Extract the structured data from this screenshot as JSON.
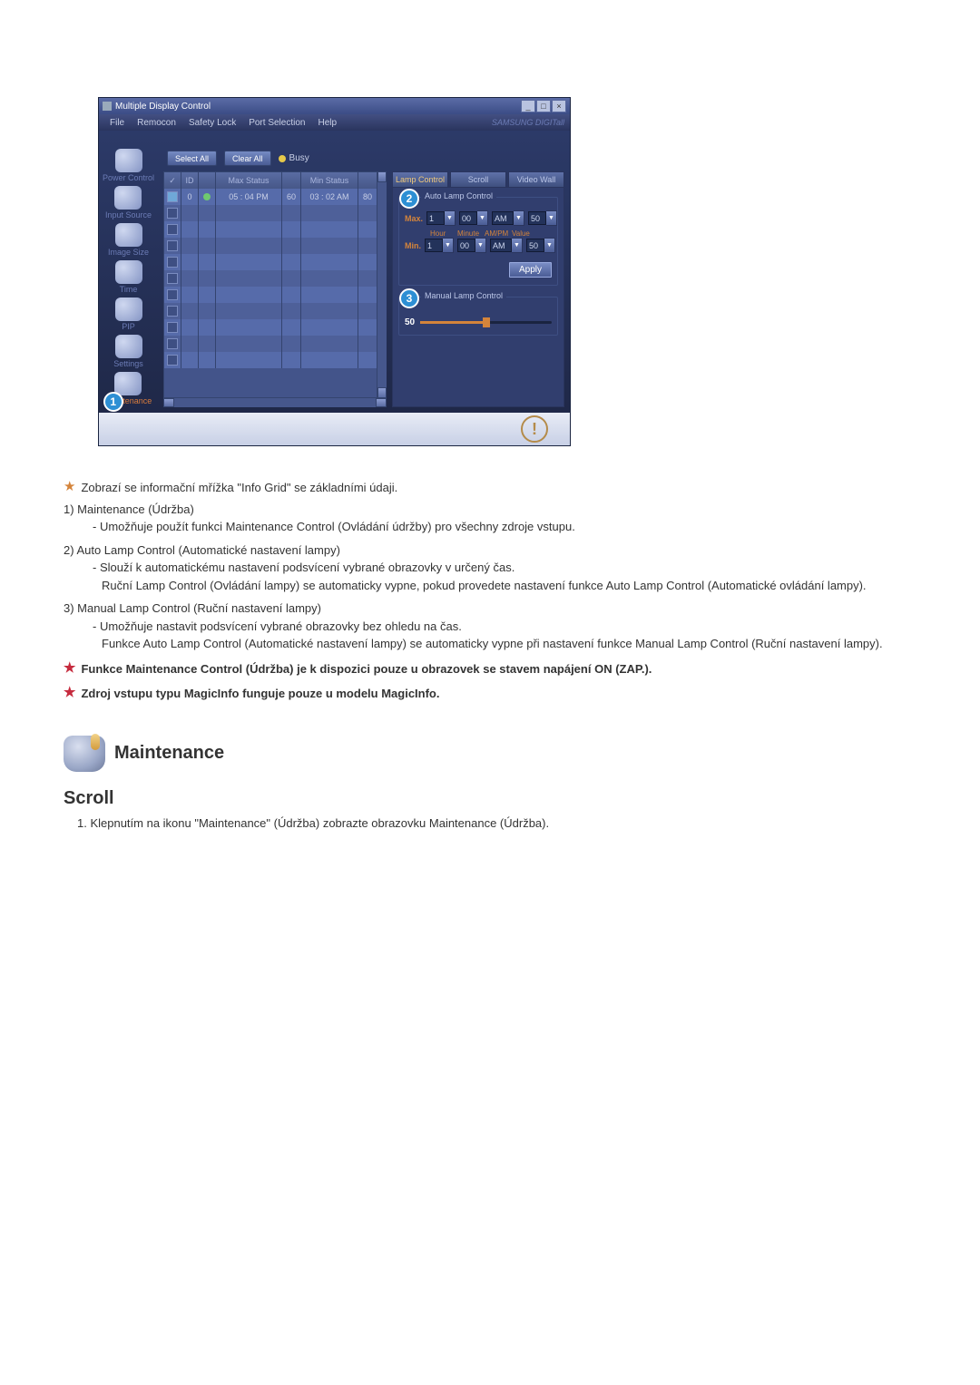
{
  "app": {
    "title": "Multiple Display Control",
    "menus": [
      "File",
      "Remocon",
      "Safety Lock",
      "Port Selection",
      "Help"
    ],
    "brand": "SAMSUNG DIGITall",
    "toolbar": {
      "selectAll": "Select All",
      "clearAll": "Clear All",
      "busy": "Busy"
    },
    "grid": {
      "headers": {
        "chk": "✓",
        "id": "ID",
        "status": "",
        "maxStatus": "Max Status",
        "maxVal": "",
        "minStatus": "Min Status",
        "minVal": ""
      },
      "row1": {
        "id": "0",
        "maxStatus": "05 : 04 PM",
        "maxVal": "60",
        "minStatus": "03 : 02 AM",
        "minVal": "80"
      }
    },
    "sidebar": {
      "items": [
        {
          "label": "Power Control"
        },
        {
          "label": "Input Source"
        },
        {
          "label": "Image Size"
        },
        {
          "label": "Time"
        },
        {
          "label": "PIP"
        },
        {
          "label": "Settings"
        },
        {
          "label": "Maintenance"
        }
      ]
    },
    "markers": {
      "m1": "1",
      "m2": "2",
      "m3": "3"
    },
    "tabs": {
      "lamp": "Lamp Control",
      "scroll": "Scroll",
      "videowall": "Video Wall"
    },
    "auto": {
      "title": "Auto Lamp Control",
      "max": "Max.",
      "min": "Min.",
      "hour": "1",
      "minute": "00",
      "ampm": "AM",
      "value": "50",
      "sub": {
        "hour": "Hour",
        "minute": "Minute",
        "ampm": "AM/PM",
        "value": "Value"
      },
      "apply": "Apply"
    },
    "manual": {
      "title": "Manual Lamp Control",
      "value": "50"
    }
  },
  "text": {
    "line1": "Zobrazí se informační mřížka \"Info Grid\" se základními údaji.",
    "n1": "1) Maintenance (Údržba)",
    "n1a": "- Umožňuje použít funkci Maintenance Control (Ovládání údržby) pro všechny zdroje vstupu.",
    "n2": "2) Auto Lamp Control (Automatické nastavení lampy)",
    "n2a": "- Slouží k automatickému nastavení podsvícení vybrané obrazovky v určený čas.",
    "n2b": "Ruční Lamp Control (Ovládání lampy) se automaticky vypne, pokud provedete nastavení funkce Auto Lamp Control (Automatické ovládání lampy).",
    "n3": "3) Manual Lamp Control (Ruční nastavení lampy)",
    "n3a": "- Umožňuje nastavit podsvícení vybrané obrazovky bez ohledu na čas.",
    "n3b": "Funkce Auto Lamp Control (Automatické nastavení lampy) se automaticky vypne při nastavení funkce Manual Lamp Control (Ruční nastavení lampy).",
    "b1": "Funkce Maintenance Control (Údržba) je k dispozici pouze u obrazovek se stavem napájení ON (ZAP.).",
    "b2": "Zdroj vstupu typu MagicInfo funguje pouze u modelu MagicInfo.",
    "sectionTitle": "Maintenance",
    "subtitle": "Scroll",
    "step1": "1.  Klepnutím na ikonu \"Maintenance\" (Údržba) zobrazte obrazovku Maintenance (Údržba)."
  }
}
